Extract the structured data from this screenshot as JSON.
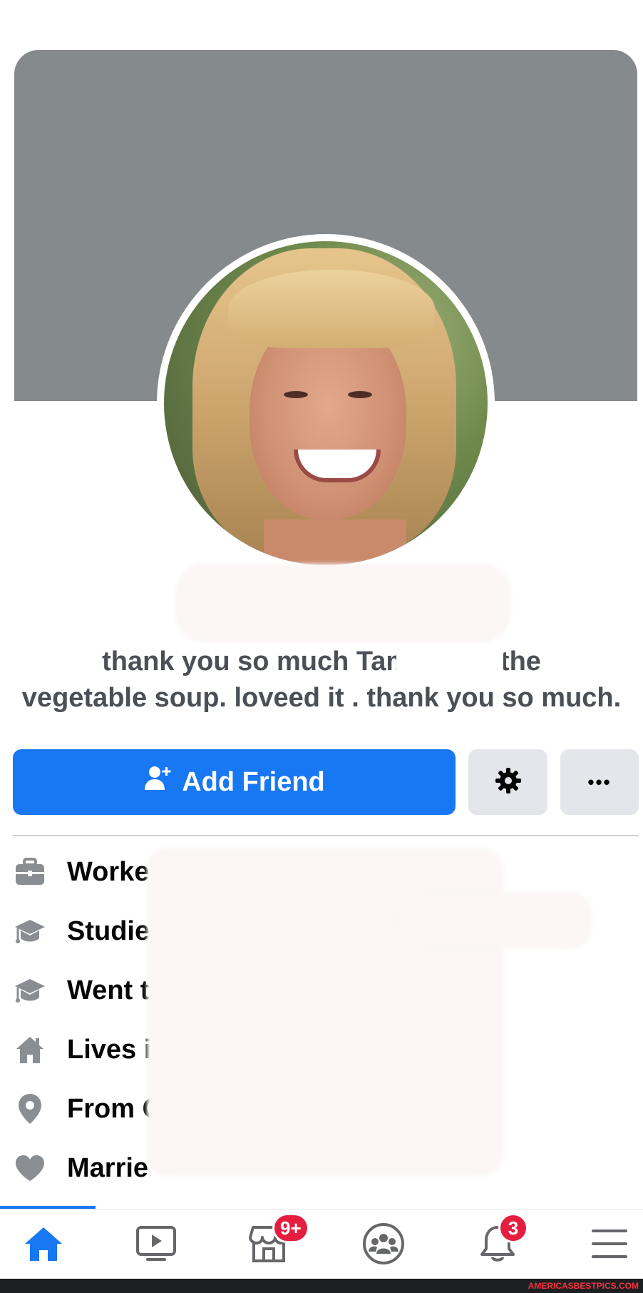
{
  "profile": {
    "caption_line1": "thank you so much Tammy       for the",
    "caption_line2": "vegetable soup.  loveed it . thank you so much."
  },
  "actions": {
    "add_friend_label": "Add Friend",
    "more_label": "•••"
  },
  "intro": {
    "items": [
      {
        "icon": "briefcase-icon",
        "text": "Worked a"
      },
      {
        "icon": "graduation-cap-icon",
        "text": "Studied a"
      },
      {
        "icon": "graduation-cap-icon",
        "text": "Went t"
      },
      {
        "icon": "house-icon",
        "text": "Lives in"
      },
      {
        "icon": "location-pin-icon",
        "text": "From C"
      },
      {
        "icon": "heart-icon",
        "text": "Marrie"
      }
    ]
  },
  "bottom_nav": {
    "items": [
      {
        "icon": "home-icon",
        "active": true
      },
      {
        "icon": "watch-video-icon"
      },
      {
        "icon": "marketplace-icon",
        "badge": "9+"
      },
      {
        "icon": "groups-icon"
      },
      {
        "icon": "notifications-bell-icon",
        "badge": "3"
      },
      {
        "icon": "menu-icon"
      }
    ]
  },
  "watermark": "AMERICASBESTPICS.COM",
  "colors": {
    "accent": "#1877f2",
    "cover": "#858a8d",
    "badge": "#e41e3f",
    "button_gray": "#e4e6eb",
    "icon_gray": "#8a8d91"
  }
}
